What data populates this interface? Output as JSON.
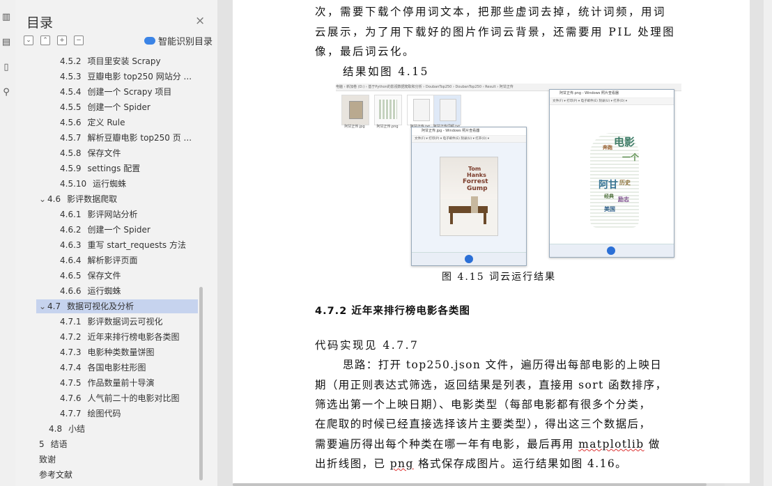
{
  "nav": {
    "title": "目录",
    "close": "×",
    "controls": [
      "⌄",
      "⌃",
      "+",
      "−"
    ],
    "smart_toc_label": "智能识别目录",
    "items": [
      {
        "num": "4.5.2",
        "text": "项目里安装 Scrapy"
      },
      {
        "num": "4.5.3",
        "text": "豆瓣电影 top250 网站分 ..."
      },
      {
        "num": "4.5.4",
        "text": "创建一个 Scrapy 项目"
      },
      {
        "num": "4.5.5",
        "text": "创建一个 Spider"
      },
      {
        "num": "4.5.6",
        "text": "定义 Rule"
      },
      {
        "num": "4.5.7",
        "text": "解析豆瓣电影 top250 页 ..."
      },
      {
        "num": "4.5.8",
        "text": "保存文件"
      },
      {
        "num": "4.5.9",
        "text": "settings 配置"
      },
      {
        "num": "4.5.10",
        "text": "运行蜘蛛"
      },
      {
        "num": "4.6",
        "text": "影评数据爬取"
      },
      {
        "num": "4.6.1",
        "text": "影评网站分析"
      },
      {
        "num": "4.6.2",
        "text": "创建一个 Spider"
      },
      {
        "num": "4.6.3",
        "text": "重写 start_requests 方法"
      },
      {
        "num": "4.6.4",
        "text": "解析影评页面"
      },
      {
        "num": "4.6.5",
        "text": "保存文件"
      },
      {
        "num": "4.6.6",
        "text": "运行蜘蛛"
      },
      {
        "num": "4.7",
        "text": "数据可视化及分析"
      },
      {
        "num": "4.7.1",
        "text": "影评数据词云可视化"
      },
      {
        "num": "4.7.2",
        "text": "近年来排行榜电影各类图"
      },
      {
        "num": "4.7.3",
        "text": "电影种类数量饼图"
      },
      {
        "num": "4.7.4",
        "text": "各国电影柱形图"
      },
      {
        "num": "4.7.5",
        "text": "作品数量前十导演"
      },
      {
        "num": "4.7.6",
        "text": "人气前二十的电影对比图"
      },
      {
        "num": "4.7.7",
        "text": "绘图代码"
      },
      {
        "num": "4.8",
        "text": "小结"
      },
      {
        "num": "5",
        "text": "结语"
      },
      {
        "num": "",
        "text": "致谢"
      },
      {
        "num": "",
        "text": "参考文献"
      }
    ]
  },
  "doc": {
    "lines": [
      "次，需要下载个停用词文本，把那些虚词去掉，统计词频，用词",
      "云展示，为了用下载好的图片作词云背景，还需要用 PIL 处理图",
      "像，最后词云化。",
      "结果如图 4.15"
    ],
    "caption": "图 4.15    词云运行结果",
    "heading": "4.7.2  近年来排行榜电影各类图",
    "code_ref": "代码实现见 4.7.7",
    "para": {
      "l1": "思路：打开 top250.json 文件，遍历得出每部电影的上映日",
      "l2": "期（用正则表达式筛选，返回结果是列表，直接用 sort 函数排序，",
      "l3": "筛选出第一个上映日期）、电影类型（每部电影都有很多个分类，",
      "l4": "在爬取的时候已经直接选择该片主要类型），得出这三个数据后，",
      "l5a": "需要遍历得出每个种类在哪一年有电影，最后再用 ",
      "l5b": "matplotlib",
      "l5c": " 做",
      "l6a": "出折线图，已 ",
      "l6b": "png",
      "l6c": " 格式保存成图片。运行结果如图 4.16。"
    }
  },
  "figure": {
    "breadcrumb": "电脑 › 新加卷 (D:) › 基于Python的影视数据爬取和分析 › DoubanTop250 › DoubanTop250 › Result › 阿甘正传",
    "files": [
      "阿甘正传.jpg",
      "阿甘正传.png",
      "阿甘正传.txt",
      "阿甘正传词频.txt"
    ],
    "win1_title": "阿甘正传.jpg - Windows 照片查看器",
    "win2_title": "阿甘正传.png - Windows 照片查看器",
    "menu": "文件(F) ▾   打印(P) ▾   电子邮件(E)   刻录(U) ▾   打开(O) ▾",
    "poster_lines": [
      "Tom",
      "Hanks",
      "Forrest",
      "Gump"
    ],
    "cloud_words": [
      "电影",
      "阿甘",
      "一个",
      "历史",
      "经典",
      "美国",
      "励志",
      "奔跑"
    ]
  },
  "colors": {
    "accent": "#3b84e6",
    "selected": "#c6d3ee"
  }
}
